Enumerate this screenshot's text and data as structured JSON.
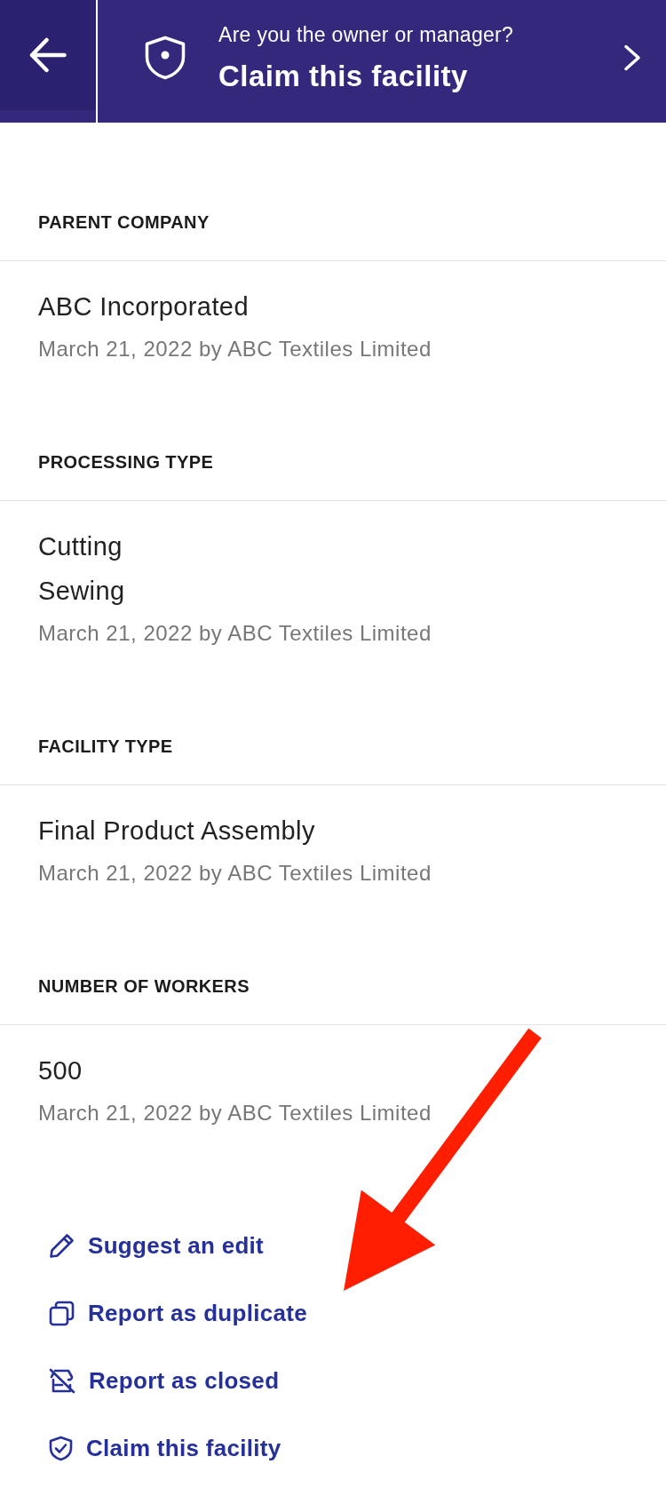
{
  "header": {
    "subtitle": "Are you the owner or manager?",
    "title": "Claim this facility"
  },
  "sections": [
    {
      "label": "PARENT COMPANY",
      "values": [
        "ABC Incorporated"
      ],
      "attribution": "March 21, 2022 by ABC Textiles Limited"
    },
    {
      "label": "PROCESSING TYPE",
      "values": [
        "Cutting",
        "Sewing"
      ],
      "attribution": "March 21, 2022 by ABC Textiles Limited"
    },
    {
      "label": "FACILITY TYPE",
      "values": [
        "Final Product Assembly"
      ],
      "attribution": "March 21, 2022 by ABC Textiles Limited"
    },
    {
      "label": "NUMBER OF WORKERS",
      "values": [
        "500"
      ],
      "attribution": "March 21, 2022 by ABC Textiles Limited"
    }
  ],
  "actions": [
    {
      "kind": "edit",
      "label": "Suggest an edit"
    },
    {
      "kind": "duplicate",
      "label": "Report as duplicate"
    },
    {
      "kind": "closed",
      "label": "Report as closed"
    },
    {
      "kind": "claim",
      "label": "Claim this facility"
    }
  ]
}
